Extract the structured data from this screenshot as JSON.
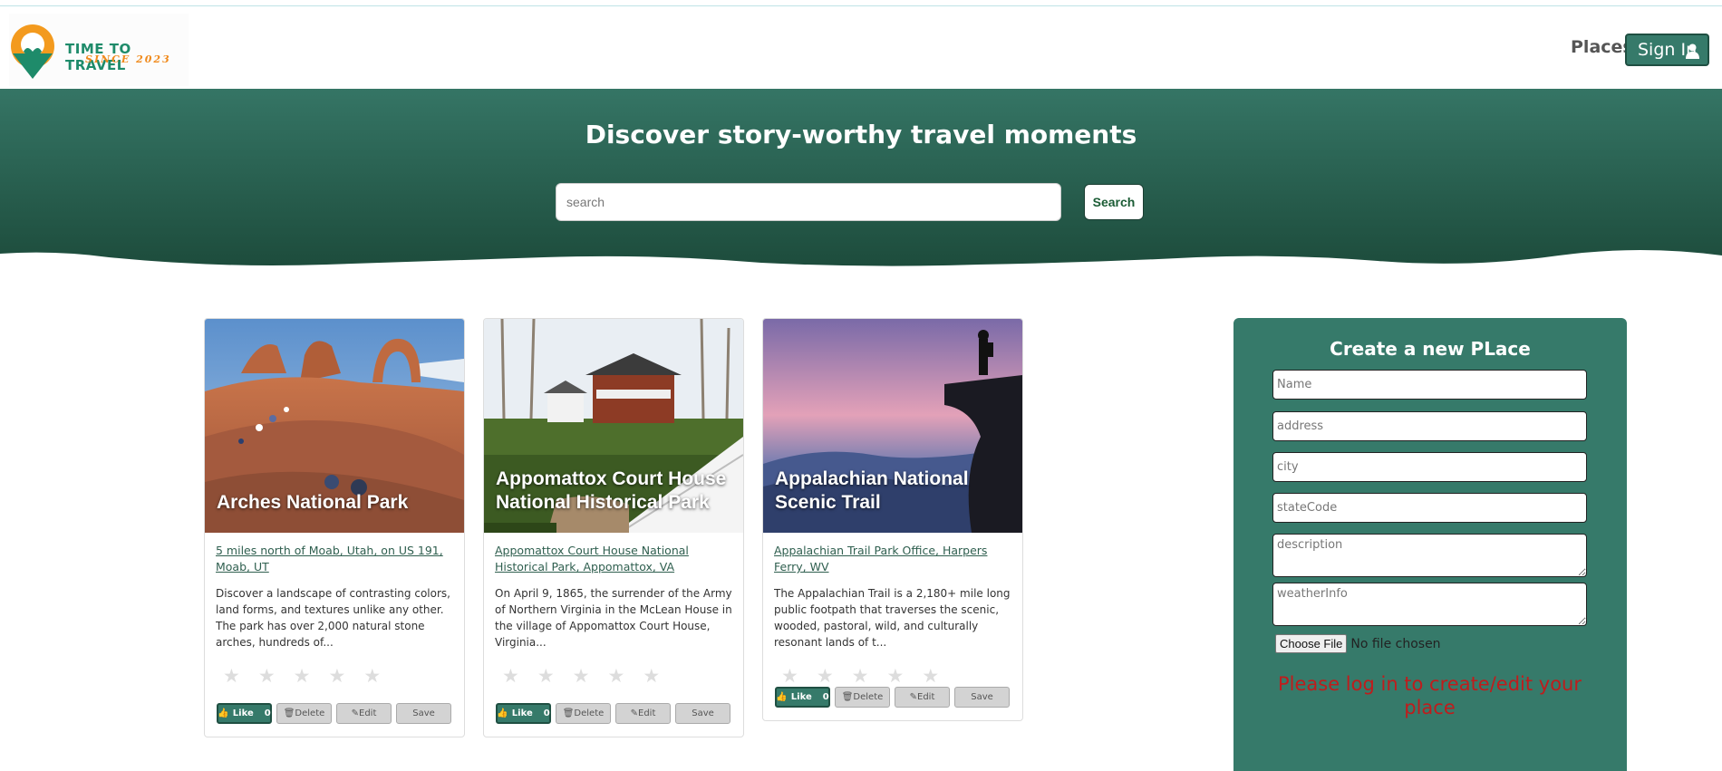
{
  "brand": {
    "logo_line1": "TIME TO TRAVEL",
    "logo_line2": "SINCE 2023",
    "icon": "map-pin-heart-logo",
    "colors": {
      "green": "#1e8b6a",
      "orange": "#f08a1c"
    }
  },
  "nav": {
    "places_label": "Places",
    "signin_label": "Sign In",
    "signin_icon": "user-icon"
  },
  "hero": {
    "title": "Discover story-worthy travel moments",
    "search_placeholder": "search",
    "search_button": "Search",
    "gradient": [
      "#357565",
      "#1d4c3c"
    ]
  },
  "cards": [
    {
      "title": "Arches National Park",
      "address": "5 miles north of Moab, Utah, on US 191, Moab, UT",
      "description": "Discover a landscape of contrasting colors, land forms, and textures unlike any other. The park has over 2,000 natural stone arches, hundreds of...",
      "rating": 0,
      "like_label": "Like",
      "likes": "0",
      "delete_label": "Delete",
      "edit_label": "Edit",
      "save_label": "Save"
    },
    {
      "title": "Appomattox Court House National Historical Park",
      "address": "Appomattox Court House National Historical Park, Appomattox, VA",
      "description": "On April 9, 1865, the surrender of the Army of Northern Virginia in the McLean House in the village of Appomattox Court House, Virginia...",
      "rating": 0,
      "like_label": "Like",
      "likes": "0",
      "delete_label": "Delete",
      "edit_label": "Edit",
      "save_label": "Save"
    },
    {
      "title": "Appalachian National Scenic Trail",
      "address": "Appalachian Trail Park Office, Harpers Ferry, WV",
      "description": "The Appalachian Trail is a 2,180+ mile long public footpath that traverses the scenic, wooded, pastoral, wild, and culturally resonant lands of t...",
      "rating": 0,
      "like_label": "Like",
      "likes": "0",
      "delete_label": "Delete",
      "edit_label": "Edit",
      "save_label": "Save"
    }
  ],
  "create_panel": {
    "title": "Create a new PLace",
    "name_placeholder": "Name",
    "address_placeholder": "address",
    "city_placeholder": "city",
    "statecode_placeholder": "stateCode",
    "description_placeholder": "description",
    "weather_placeholder": "weatherInfo",
    "file_button": "Choose File",
    "file_status": "No file chosen",
    "login_message": "Please log in to create/edit your place",
    "bg_color": "#367a6a",
    "message_color": "#c01c1c"
  }
}
